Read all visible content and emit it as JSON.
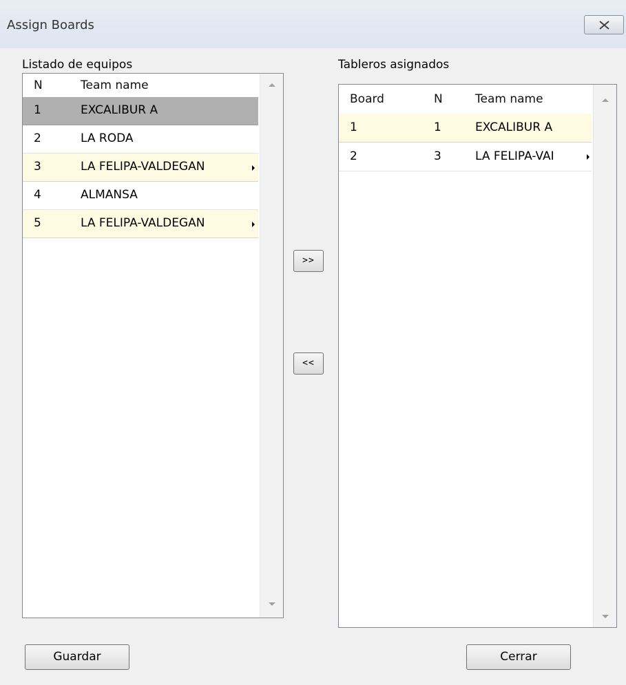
{
  "window": {
    "title": "Assign Boards"
  },
  "left_panel": {
    "label": "Listado de equipos",
    "columns": [
      "N",
      "Team name"
    ],
    "rows": [
      {
        "n": "1",
        "team": "EXCALIBUR A",
        "state": "selected"
      },
      {
        "n": "2",
        "team": "LA RODA",
        "state": "normal"
      },
      {
        "n": "3",
        "team": "LA FELIPA-VALDEGAN",
        "state": "alt",
        "truncated": true
      },
      {
        "n": "4",
        "team": "ALMANSA",
        "state": "normal"
      },
      {
        "n": "5",
        "team": "LA FELIPA-VALDEGAN",
        "state": "alt",
        "truncated": true
      }
    ]
  },
  "right_panel": {
    "label": "Tableros asignados",
    "columns": [
      "Board",
      "N",
      "Team name"
    ],
    "rows": [
      {
        "board": "1",
        "n": "1",
        "team": "EXCALIBUR A",
        "state": "alt"
      },
      {
        "board": "2",
        "n": "3",
        "team": "LA FELIPA-VAI",
        "state": "normal",
        "truncated": true
      }
    ]
  },
  "buttons": {
    "move_right": ">>",
    "move_left": "<<",
    "save": "Guardar",
    "close": "Cerrar"
  },
  "colors": {
    "selected_row": "#b0b0b0",
    "alt_row": "#fffbe3",
    "dialog_bg": "#f0f0f0"
  },
  "icons": {
    "close": "close-x-icon",
    "truncate": "truncate-arrow-icon",
    "scroll_up": "scroll-up-arrow-icon",
    "scroll_down": "scroll-down-arrow-icon"
  }
}
